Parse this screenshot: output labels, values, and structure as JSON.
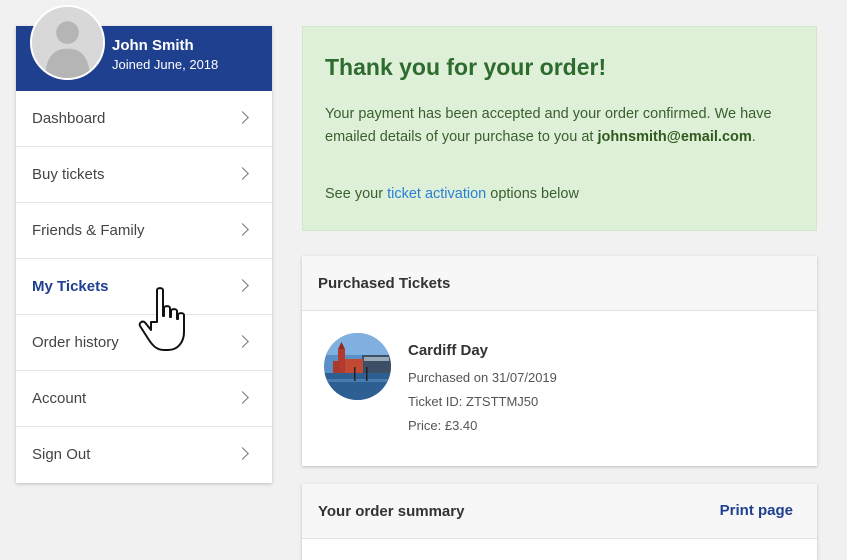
{
  "profile": {
    "name": "John Smith",
    "joined": "Joined June, 2018"
  },
  "menu": {
    "items": [
      {
        "label": "Dashboard"
      },
      {
        "label": "Buy tickets"
      },
      {
        "label": "Friends & Family"
      },
      {
        "label": "My Tickets",
        "active": true
      },
      {
        "label": "Order history"
      },
      {
        "label": "Account"
      },
      {
        "label": "Sign Out"
      }
    ]
  },
  "banner": {
    "title": "Thank you for your order!",
    "text": "Your payment has been accepted and your order confirmed. We have emailed details of your purchase to you at",
    "email": "johnsmith@email.com",
    "email_suffix": ".",
    "activation_prefix": "See your",
    "activation_link": "ticket activation",
    "activation_suffix": "options below"
  },
  "purchased": {
    "title": "Purchased Tickets",
    "ticket": {
      "name": "Cardiff Day",
      "purchased": "Purchased on 31/07/2019",
      "ticket_id": "Ticket ID: ZTSTTMJ50",
      "price": "Price: £3.40"
    }
  },
  "summary": {
    "title": "Your order summary",
    "print_label": "Print page"
  },
  "colors": {
    "brand_blue": "#1f3f8f",
    "success_bg": "#dff0d8",
    "success_text": "#2e6b2e",
    "link_blue": "#2a7fd4"
  },
  "icons": {
    "avatar": "user-silhouette-icon",
    "chevron": "chevron-right-icon",
    "cursor": "hand-pointer-icon"
  }
}
